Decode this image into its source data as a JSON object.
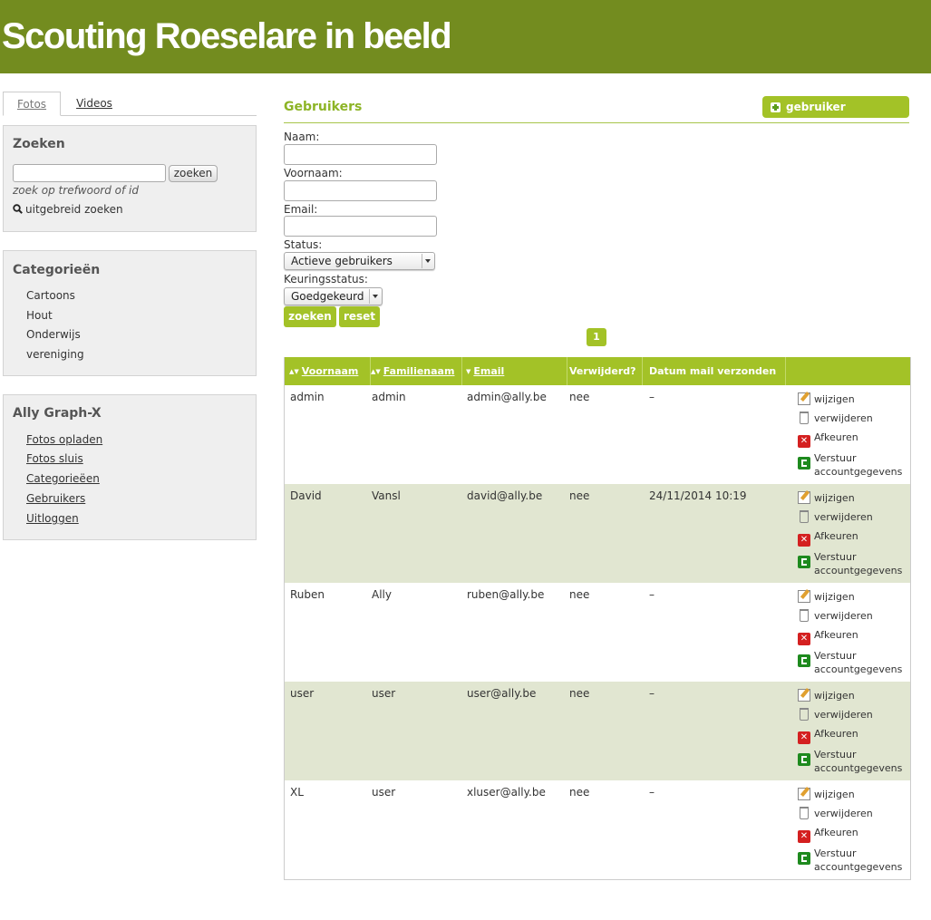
{
  "site": {
    "title": "Scouting Roeselare in beeld"
  },
  "tabs": [
    {
      "label": "Fotos"
    },
    {
      "label": "Videos"
    }
  ],
  "search": {
    "title": "Zoeken",
    "input_value": "",
    "button": "zoeken",
    "hint": "zoek op trefwoord of id",
    "advanced": "uitgebreid zoeken"
  },
  "categories": {
    "title": "Categorieën",
    "items": [
      "Cartoons",
      "Hout",
      "Onderwijs",
      "vereniging"
    ]
  },
  "ally": {
    "title": "Ally Graph-X",
    "items": [
      "Fotos opladen",
      "Fotos sluis",
      "Categorieëen",
      "Gebruikers",
      "Uitloggen"
    ]
  },
  "main": {
    "title": "Gebruikers",
    "add_button": "gebruiker toevoegen"
  },
  "filters": {
    "naam_label": "Naam:",
    "naam_value": "",
    "voornaam_label": "Voornaam:",
    "voornaam_value": "",
    "email_label": "Email:",
    "email_value": "",
    "status_label": "Status:",
    "status_value": "Actieve gebruikers",
    "keuring_label": "Keuringsstatus:",
    "keuring_value": "Goedgekeurd",
    "search_button": "zoeken",
    "reset_button": "reset"
  },
  "pager": {
    "current": "1"
  },
  "table": {
    "columns": [
      "Voornaam",
      "Familienaam",
      "Email",
      "Verwijderd?",
      "Datum mail verzonden"
    ],
    "actions": {
      "edit": "wijzigen",
      "delete": "verwijderen",
      "reject": "Afkeuren",
      "send_line1": "Verstuur",
      "send_line2": "accountgegevens"
    },
    "rows": [
      {
        "voornaam": "admin",
        "familienaam": "admin",
        "email": "admin@ally.be",
        "verwijderd": "nee",
        "datum": "–"
      },
      {
        "voornaam": "David",
        "familienaam": "Vansl",
        "email": "david@ally.be",
        "verwijderd": "nee",
        "datum": "24/11/2014 10:19"
      },
      {
        "voornaam": "Ruben",
        "familienaam": "Ally",
        "email": "ruben@ally.be",
        "verwijderd": "nee",
        "datum": "–"
      },
      {
        "voornaam": "user",
        "familienaam": "user",
        "email": "user@ally.be",
        "verwijderd": "nee",
        "datum": "–"
      },
      {
        "voornaam": "XL",
        "familienaam": "user",
        "email": "xluser@ally.be",
        "verwijderd": "nee",
        "datum": "–"
      }
    ]
  }
}
